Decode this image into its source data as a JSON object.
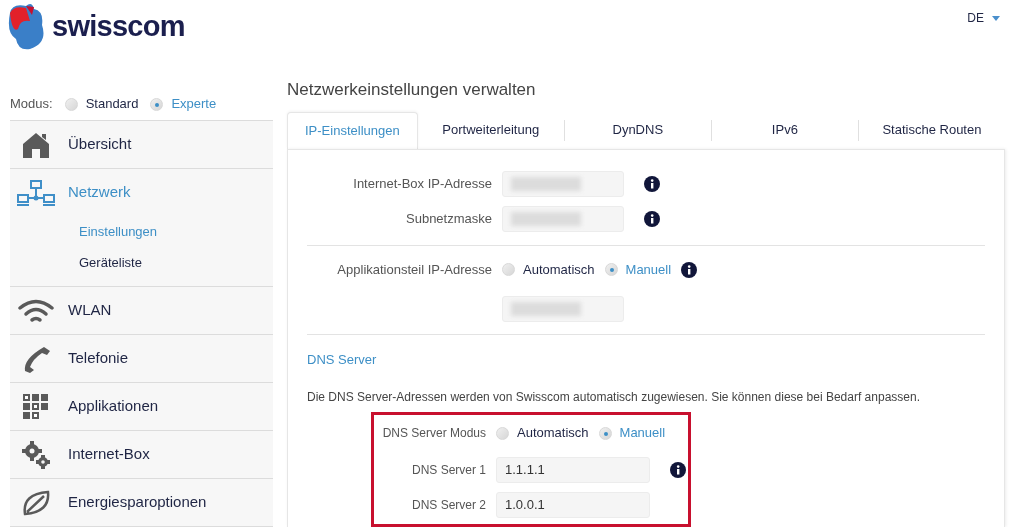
{
  "brand": {
    "name": "swisscom"
  },
  "language": {
    "label": "DE"
  },
  "mode": {
    "label": "Modus:",
    "options": [
      {
        "label": "Standard",
        "selected": false
      },
      {
        "label": "Experte",
        "selected": true
      }
    ]
  },
  "nav": [
    {
      "label": "Übersicht",
      "kind": "home",
      "selected": false
    },
    {
      "label": "Netzwerk",
      "kind": "network",
      "selected": true,
      "children": [
        {
          "label": "Einstellungen",
          "selected": true
        },
        {
          "label": "Geräteliste",
          "selected": false
        }
      ]
    },
    {
      "label": "WLAN",
      "kind": "wifi",
      "selected": false
    },
    {
      "label": "Telefonie",
      "kind": "phone",
      "selected": false
    },
    {
      "label": "Applikationen",
      "kind": "apps",
      "selected": false
    },
    {
      "label": "Internet-Box",
      "kind": "gears",
      "selected": false
    },
    {
      "label": "Energiesparoptionen",
      "kind": "leaf",
      "selected": false
    }
  ],
  "page_title": "Netzwerkeinstellungen verwalten",
  "tabs": [
    {
      "label": "IP-Einstellungen",
      "selected": true
    },
    {
      "label": "Portweiterleitung",
      "selected": false
    },
    {
      "label": "DynDNS",
      "selected": false
    },
    {
      "label": "IPv6",
      "selected": false
    },
    {
      "label": "Statische Routen",
      "selected": false
    }
  ],
  "ip_fields": [
    {
      "label": "Internet-Box IP-Adresse",
      "redacted": true,
      "info": true
    },
    {
      "label": "Subnetzmaske",
      "redacted": true,
      "info": true
    }
  ],
  "app_ip": {
    "label": "Applikationsteil IP-Adresse",
    "options": [
      {
        "label": "Automatisch",
        "selected": false
      },
      {
        "label": "Manuell",
        "selected": true
      }
    ],
    "info": true,
    "field": {
      "redacted": true
    }
  },
  "dns": {
    "heading": "DNS Server",
    "description": "Die DNS Server-Adressen werden von Swisscom automatisch zugewiesen. Sie können diese bei Bedarf anpassen.",
    "highlighted": true,
    "mode": {
      "label": "DNS Server Modus",
      "options": [
        {
          "label": "Automatisch",
          "selected": false
        },
        {
          "label": "Manuell",
          "selected": true
        }
      ]
    },
    "servers": [
      {
        "label": "DNS Server 1",
        "value": "1.1.1.1",
        "info": true
      },
      {
        "label": "DNS Server 2",
        "value": "1.0.0.1",
        "info": false
      }
    ]
  }
}
